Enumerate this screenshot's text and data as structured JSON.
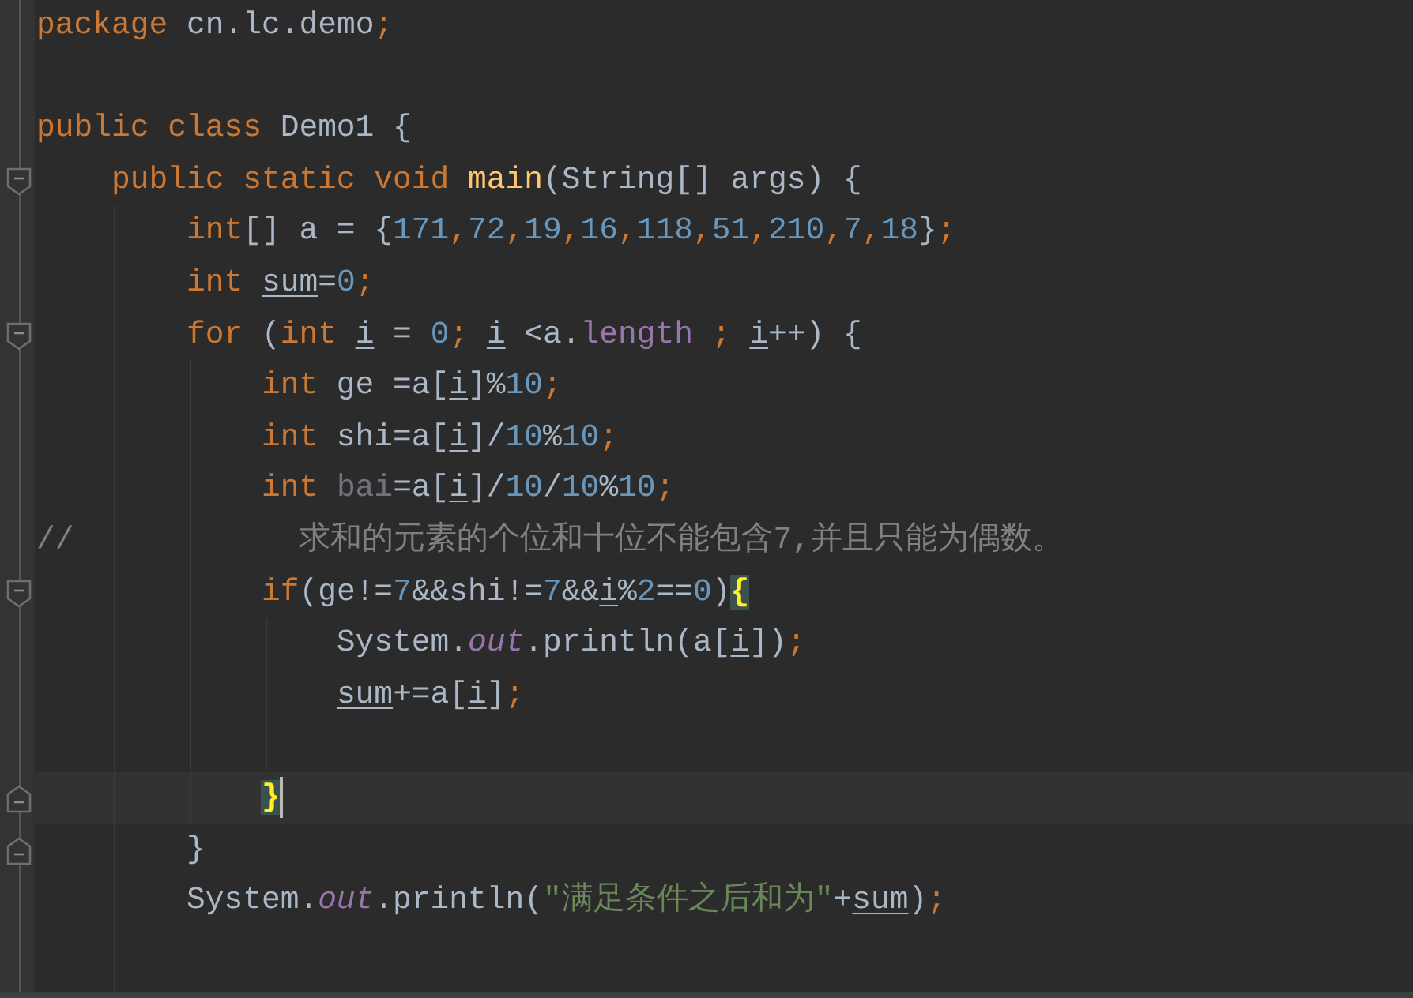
{
  "editor": {
    "lines": [
      {
        "kind": "code",
        "current": false,
        "tokens": [
          {
            "kind": "keyword",
            "text": "package"
          },
          {
            "kind": "plain",
            "text": " cn.lc.demo"
          },
          {
            "kind": "keyword",
            "text": ";"
          }
        ]
      },
      {
        "kind": "blank",
        "current": false
      },
      {
        "kind": "code",
        "current": false,
        "tokens": [
          {
            "kind": "keyword",
            "text": "public class"
          },
          {
            "kind": "plain",
            "text": " Demo1 {"
          }
        ]
      },
      {
        "kind": "fold-start",
        "current": false,
        "tokens": [
          {
            "kind": "keyword",
            "text": "    public static void "
          },
          {
            "kind": "method",
            "text": "main"
          },
          {
            "kind": "plain",
            "text": "(String[] args) {"
          }
        ]
      },
      {
        "kind": "code",
        "current": false,
        "tokens": [
          {
            "kind": "keyword",
            "text": "        int"
          },
          {
            "kind": "plain",
            "text": "[] a = {"
          },
          {
            "kind": "number",
            "text": "171"
          },
          {
            "kind": "keyword",
            "text": ","
          },
          {
            "kind": "number",
            "text": "72"
          },
          {
            "kind": "keyword",
            "text": ","
          },
          {
            "kind": "number",
            "text": "19"
          },
          {
            "kind": "keyword",
            "text": ","
          },
          {
            "kind": "number",
            "text": "16"
          },
          {
            "kind": "keyword",
            "text": ","
          },
          {
            "kind": "number",
            "text": "118"
          },
          {
            "kind": "keyword",
            "text": ","
          },
          {
            "kind": "number",
            "text": "51"
          },
          {
            "kind": "keyword",
            "text": ","
          },
          {
            "kind": "number",
            "text": "210"
          },
          {
            "kind": "keyword",
            "text": ","
          },
          {
            "kind": "number",
            "text": "7"
          },
          {
            "kind": "keyword",
            "text": ","
          },
          {
            "kind": "number",
            "text": "18"
          },
          {
            "kind": "plain",
            "text": "}"
          },
          {
            "kind": "keyword",
            "text": ";"
          }
        ]
      },
      {
        "kind": "code",
        "current": false,
        "tokens": [
          {
            "kind": "keyword",
            "text": "        int "
          },
          {
            "kind": "variable",
            "text": "sum"
          },
          {
            "kind": "plain",
            "text": "="
          },
          {
            "kind": "number",
            "text": "0"
          },
          {
            "kind": "keyword",
            "text": ";"
          }
        ]
      },
      {
        "kind": "fold-start",
        "current": false,
        "tokens": [
          {
            "kind": "keyword",
            "text": "        for"
          },
          {
            "kind": "plain",
            "text": " ("
          },
          {
            "kind": "keyword",
            "text": "int "
          },
          {
            "kind": "variable",
            "text": "i"
          },
          {
            "kind": "plain",
            "text": " = "
          },
          {
            "kind": "number",
            "text": "0"
          },
          {
            "kind": "keyword",
            "text": "; "
          },
          {
            "kind": "variable",
            "text": "i"
          },
          {
            "kind": "plain",
            "text": " <a."
          },
          {
            "kind": "field",
            "text": "length"
          },
          {
            "kind": "keyword",
            "text": " ; "
          },
          {
            "kind": "variable",
            "text": "i"
          },
          {
            "kind": "plain",
            "text": "++) {"
          }
        ]
      },
      {
        "kind": "code",
        "current": false,
        "tokens": [
          {
            "kind": "keyword",
            "text": "            int"
          },
          {
            "kind": "plain",
            "text": " ge =a["
          },
          {
            "kind": "variable",
            "text": "i"
          },
          {
            "kind": "plain",
            "text": "]%"
          },
          {
            "kind": "number",
            "text": "10"
          },
          {
            "kind": "keyword",
            "text": ";"
          }
        ]
      },
      {
        "kind": "code",
        "current": false,
        "tokens": [
          {
            "kind": "keyword",
            "text": "            int"
          },
          {
            "kind": "plain",
            "text": " shi=a["
          },
          {
            "kind": "variable",
            "text": "i"
          },
          {
            "kind": "plain",
            "text": "]/"
          },
          {
            "kind": "number",
            "text": "10"
          },
          {
            "kind": "plain",
            "text": "%"
          },
          {
            "kind": "number",
            "text": "10"
          },
          {
            "kind": "keyword",
            "text": ";"
          }
        ]
      },
      {
        "kind": "code",
        "current": false,
        "tokens": [
          {
            "kind": "keyword",
            "text": "            int "
          },
          {
            "kind": "unused",
            "text": "bai"
          },
          {
            "kind": "plain",
            "text": "=a["
          },
          {
            "kind": "variable",
            "text": "i"
          },
          {
            "kind": "plain",
            "text": "]/"
          },
          {
            "kind": "number",
            "text": "10"
          },
          {
            "kind": "plain",
            "text": "/"
          },
          {
            "kind": "number",
            "text": "10"
          },
          {
            "kind": "plain",
            "text": "%"
          },
          {
            "kind": "number",
            "text": "10"
          },
          {
            "kind": "keyword",
            "text": ";"
          }
        ]
      },
      {
        "kind": "code",
        "current": false,
        "tokens": [
          {
            "kind": "comment",
            "text": "//            求和的元素的个位和十位不能包含7,并且只能为偶数。"
          }
        ]
      },
      {
        "kind": "fold-start",
        "current": false,
        "tokens": [
          {
            "kind": "keyword",
            "text": "            if"
          },
          {
            "kind": "plain",
            "text": "(ge!="
          },
          {
            "kind": "number",
            "text": "7"
          },
          {
            "kind": "plain",
            "text": "&&shi!="
          },
          {
            "kind": "number",
            "text": "7"
          },
          {
            "kind": "plain",
            "text": "&&"
          },
          {
            "kind": "variable",
            "text": "i"
          },
          {
            "kind": "plain",
            "text": "%"
          },
          {
            "kind": "number",
            "text": "2"
          },
          {
            "kind": "plain",
            "text": "=="
          },
          {
            "kind": "number",
            "text": "0"
          },
          {
            "kind": "plain",
            "text": ")"
          },
          {
            "kind": "brace-match",
            "text": "{"
          }
        ]
      },
      {
        "kind": "code",
        "current": false,
        "tokens": [
          {
            "kind": "plain",
            "text": "                System."
          },
          {
            "kind": "static-field",
            "text": "out"
          },
          {
            "kind": "plain",
            "text": ".println(a["
          },
          {
            "kind": "variable",
            "text": "i"
          },
          {
            "kind": "plain",
            "text": "])"
          },
          {
            "kind": "keyword",
            "text": ";"
          }
        ]
      },
      {
        "kind": "code",
        "current": false,
        "tokens": [
          {
            "kind": "variable",
            "text": "                sum"
          },
          {
            "kind": "plain",
            "text": "+=a["
          },
          {
            "kind": "variable",
            "text": "i"
          },
          {
            "kind": "plain",
            "text": "]"
          },
          {
            "kind": "keyword",
            "text": ";"
          }
        ]
      },
      {
        "kind": "blank",
        "current": false
      },
      {
        "kind": "fold-end",
        "current": true,
        "tokens": [
          {
            "kind": "brace-match",
            "text": "            }"
          }
        ]
      },
      {
        "kind": "fold-end",
        "current": false,
        "tokens": [
          {
            "kind": "plain",
            "text": "        }"
          }
        ]
      },
      {
        "kind": "code",
        "current": false,
        "tokens": [
          {
            "kind": "plain",
            "text": "        System."
          },
          {
            "kind": "static-field",
            "text": "out"
          },
          {
            "kind": "plain",
            "text": ".println("
          },
          {
            "kind": "string",
            "text": "\"满足条件之后和为\""
          },
          {
            "kind": "plain",
            "text": "+"
          },
          {
            "kind": "variable",
            "text": "sum"
          },
          {
            "kind": "plain",
            "text": ")"
          },
          {
            "kind": "keyword",
            "text": ";"
          }
        ]
      }
    ]
  }
}
